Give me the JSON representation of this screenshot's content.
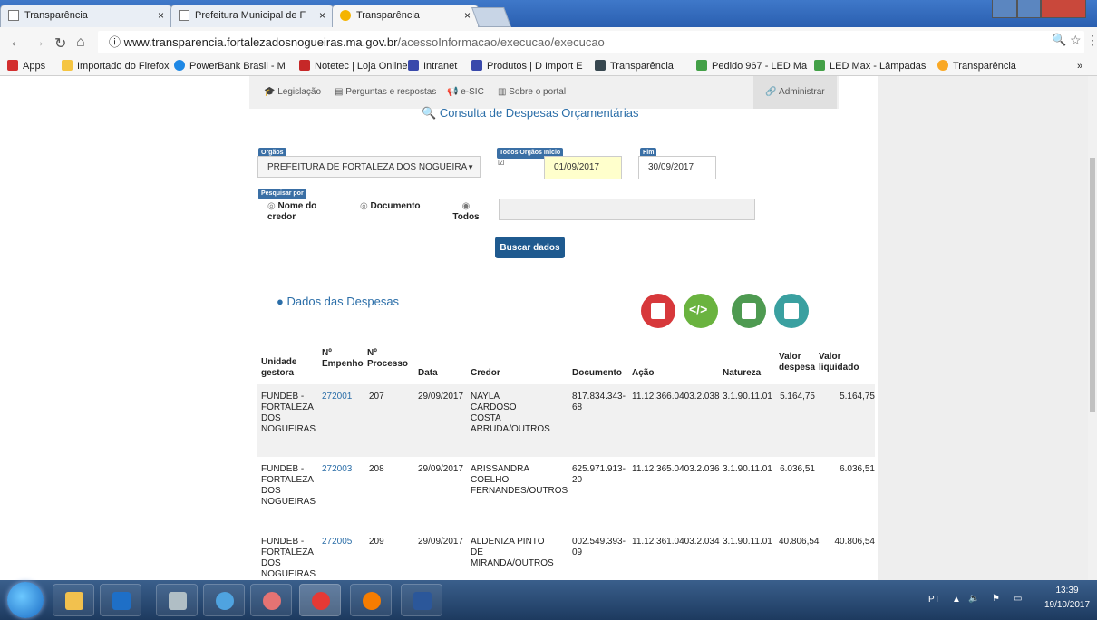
{
  "browser": {
    "tabs": [
      {
        "label": "Transparência",
        "active": false
      },
      {
        "label": "Prefeitura Municipal de F",
        "active": false
      },
      {
        "label": "Transparência",
        "active": true
      }
    ],
    "url_prefix": "ⓘ www.transparencia.fortalezadosnogueiras.ma.gov.br",
    "url_path": "/acessoInformacao/execucao/execucao",
    "bookmarks": [
      {
        "label": "Apps",
        "color": "#d32f2f"
      },
      {
        "label": "Importado do Firefox",
        "color": "#f5c542"
      },
      {
        "label": "PowerBank Brasil - M",
        "color": "#1e88e5"
      },
      {
        "label": "Notetec | Loja Online",
        "color": "#c62828"
      },
      {
        "label": "Intranet",
        "color": "#3949ab"
      },
      {
        "label": "Produtos | D Import E",
        "color": "#3949ab"
      },
      {
        "label": "Transparência",
        "color": "#37474f"
      },
      {
        "label": "Pedido 967 - LED Ma",
        "color": "#43a047"
      },
      {
        "label": "LED Max - Lâmpadas",
        "color": "#43a047"
      },
      {
        "label": "Transparência",
        "color": "#f9a825"
      }
    ],
    "more": "»"
  },
  "nav": {
    "items": [
      "Legislação",
      "Perguntas e respostas",
      "e-SIC",
      "Sobre o portal"
    ],
    "admin": "Administrar"
  },
  "page_title": "Consulta de Despesas Orçamentárias",
  "form": {
    "orgaos_label": "Orgãos",
    "orgaos_value": "PREFEITURA DE FORTALEZA DOS NOGUEIRA",
    "todos_orgaos_label": "Todos Orgãos",
    "inicio_label": "Inicio",
    "inicio_value": "01/09/2017",
    "fim_label": "Fim",
    "fim_value": "30/09/2017",
    "pesquisar_label": "Pesquisar por",
    "radio_nome": "Nome do credor",
    "radio_documento": "Documento",
    "radio_todos": "Todos",
    "buscar": "Buscar dados"
  },
  "dados_title": "Dados das Despesas",
  "export_icons": [
    {
      "name": "pdf-icon",
      "color": "#d7383b"
    },
    {
      "name": "code-icon",
      "color": "#6ab33f"
    },
    {
      "name": "xls-icon",
      "color": "#4e9a51"
    },
    {
      "name": "json-icon",
      "color": "#3aa0a0"
    }
  ],
  "table": {
    "headers": [
      "Unidade gestora",
      "Nº Empenho",
      "Nº Processo",
      "Data",
      "Credor",
      "Documento",
      "Ação",
      "Natureza",
      "Valor despesa",
      "Valor liquidado"
    ],
    "rows": [
      {
        "unidade": "FUNDEB - FORTALEZA DOS NOGUEIRAS",
        "empenho": "272001",
        "processo": "207",
        "data": "29/09/2017",
        "credor": "NAYLA CARDOSO COSTA ARRUDA/OUTROS",
        "documento": "817.834.343-68",
        "acao": "11.12.366.0403.2.038",
        "natureza": "3.1.90.11.01",
        "valor_despesa": "5.164,75",
        "valor_liquidado": "5.164,75"
      },
      {
        "unidade": "FUNDEB - FORTALEZA DOS NOGUEIRAS",
        "empenho": "272003",
        "processo": "208",
        "data": "29/09/2017",
        "credor": "ARISSANDRA COELHO FERNANDES/OUTROS",
        "documento": "625.971.913-20",
        "acao": "11.12.365.0403.2.036",
        "natureza": "3.1.90.11.01",
        "valor_despesa": "6.036,51",
        "valor_liquidado": "6.036,51"
      },
      {
        "unidade": "FUNDEB - FORTALEZA DOS NOGUEIRAS",
        "empenho": "272005",
        "processo": "209",
        "data": "29/09/2017",
        "credor": "ALDENIZA PINTO DE MIRANDA/OUTROS",
        "documento": "002.549.393-09",
        "acao": "11.12.361.0403.2.034",
        "natureza": "3.1.90.11.01",
        "valor_despesa": "40.806,54",
        "valor_liquidado": "40.806,54"
      }
    ]
  },
  "taskbar": {
    "language": "PT",
    "time": "13:39",
    "date": "19/10/2017"
  }
}
